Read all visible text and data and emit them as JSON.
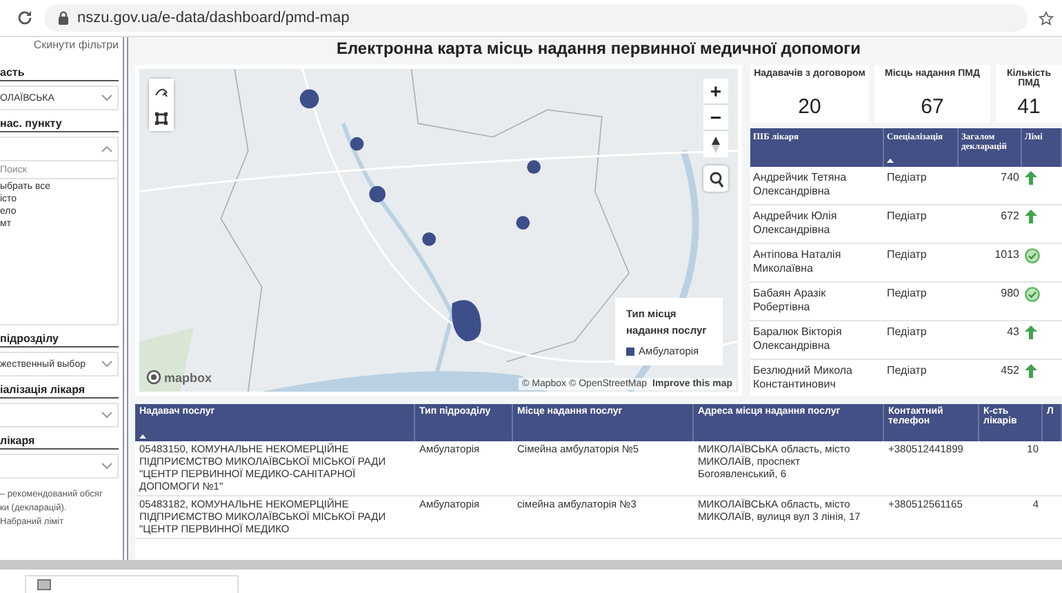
{
  "browser": {
    "url": "nszu.gov.ua/e-data/dashboard/pmd-map"
  },
  "sidebar": {
    "reset_link": "Скинути фільтри",
    "filters": [
      {
        "kind": "dropdown",
        "label": "асть",
        "value": "ОЛАЇВСЬКА",
        "expanded": false
      },
      {
        "kind": "list",
        "label": "нас. пункту",
        "expanded": true,
        "search_placeholder": "Поиск",
        "options": [
          "ыбрать все",
          "істо",
          "ело",
          "мт"
        ]
      },
      {
        "kind": "dropdown",
        "label": "підрозділу",
        "value": "жественный выбор",
        "expanded": false
      },
      {
        "kind": "dropdown",
        "label": "іалізація лікаря",
        "expanded": false
      },
      {
        "kind": "dropdown",
        "label": "лікаря",
        "expanded": false
      }
    ],
    "notes": [
      "– рекомендований обсяг",
      "ки (декларацій).",
      "Набраний ліміт"
    ]
  },
  "title": "Електронна карта місць надання первинної медичної допомоги",
  "map": {
    "zoom_in": "+",
    "zoom_out": "−",
    "logo": "mapbox",
    "attribution": "© Mapbox © OpenStreetMap",
    "improve_link": "Improve this map",
    "legend": {
      "title": "Тип місця надання послуг",
      "items": [
        {
          "label": "Амбулаторія",
          "color": "#3d4f8a"
        }
      ]
    }
  },
  "cards": [
    {
      "label": "Надавачів з договором",
      "value": "20"
    },
    {
      "label": "Місць надання ПМД",
      "value": "67"
    },
    {
      "label": "Кількість ПМД",
      "value": "41"
    }
  ],
  "doctors": {
    "columns": [
      {
        "label": "ПІБ лікаря",
        "sorted": false
      },
      {
        "label": "Спеціалізація",
        "sorted": true
      },
      {
        "label": "Загалом декларацій",
        "sorted": false
      },
      {
        "label": "Лімі",
        "sorted": false
      }
    ],
    "rows": [
      {
        "name": "Андрейчик Тетяна Олександрівна",
        "specialization": "Педіатр",
        "declarations": "740",
        "limit_reached": false
      },
      {
        "name": "Андрейчик Юлія Олександрівна",
        "specialization": "Педіатр",
        "declarations": "672",
        "limit_reached": false
      },
      {
        "name": "Антіпова Наталія Миколаївна",
        "specialization": "Педіатр",
        "declarations": "1013",
        "limit_reached": true
      },
      {
        "name": "Бабаян Аразік Робертівна",
        "specialization": "Педіатр",
        "declarations": "980",
        "limit_reached": true
      },
      {
        "name": "Баралюк Вікторія Олександрівна",
        "specialization": "Педіатр",
        "declarations": "43",
        "limit_reached": false
      },
      {
        "name": "Безлюдний Микола Константинович",
        "specialization": "Педіатр",
        "declarations": "452",
        "limit_reached": false
      }
    ]
  },
  "providers": {
    "columns": [
      {
        "label": "Надавач послуг",
        "sorted": true
      },
      {
        "label": "Тип підрозділу",
        "sorted": false
      },
      {
        "label": "Місце надання послуг",
        "sorted": false
      },
      {
        "label": "Адреса місця надання послуг",
        "sorted": false
      },
      {
        "label": "Контактний телефон",
        "sorted": false
      },
      {
        "label": "К-сть лікарів",
        "sorted": false
      },
      {
        "label": "Л",
        "sorted": false
      }
    ],
    "rows": [
      {
        "provider": "05483150, КОМУНАЛЬНЕ НЕКОМЕРЦІЙНЕ ПІДПРИЄМСТВО МИКОЛАЇВСЬКОЇ МІСЬКОЇ РАДИ \"ЦЕНТР ПЕРВИННОЇ МЕДИКО-САНІТАРНОЇ ДОПОМОГИ №1\"",
        "unit_type": "Амбулаторія",
        "place": "Сімейна амбулаторія №5",
        "address": "МИКОЛАЇВСЬКА область, місто МИКОЛАЇВ, проспект Богоявленський, 6",
        "phone": "+380512441899",
        "doctors": "10"
      },
      {
        "provider": "05483182, КОМУНАЛЬНЕ НЕКОМЕРЦІЙНЕ ПІДПРИЄМСТВО МИКОЛАЇВСЬКОЇ МІСЬКОЇ РАДИ \"ЦЕНТР ПЕРВИННОЇ МЕДИКО",
        "unit_type": "Амбулаторія",
        "place": "сімейна амбулаторія №3",
        "address": "МИКОЛАЇВСЬКА область, місто МИКОЛАЇВ, вулиця вул 3 лінія, 17",
        "phone": "+380512561165",
        "doctors": "4"
      }
    ]
  }
}
